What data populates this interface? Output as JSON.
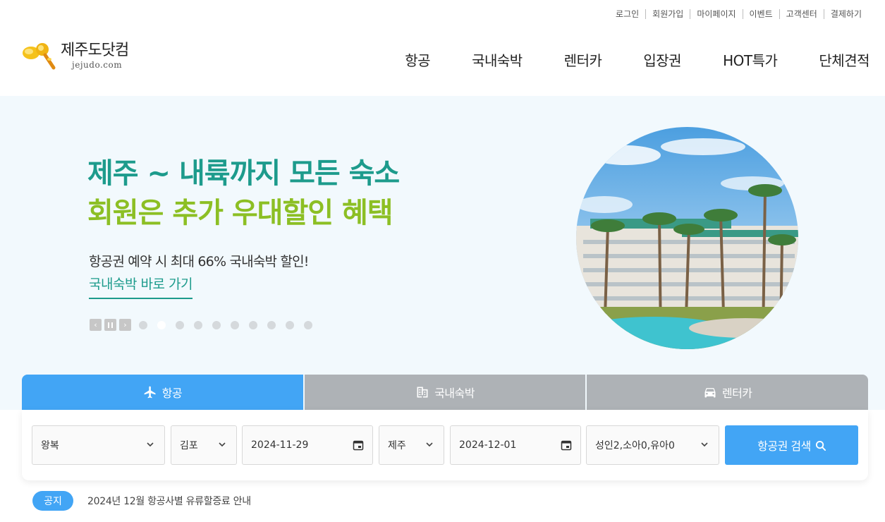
{
  "utility_nav": [
    "로그인",
    "회원가입",
    "마이페이지",
    "이벤트",
    "고객센터",
    "결제하기"
  ],
  "logo": {
    "name": "제주도닷컴",
    "domain": "jejudo.com"
  },
  "main_nav": [
    "항공",
    "국내숙박",
    "렌터카",
    "입장권",
    "HOT특가",
    "단체견적"
  ],
  "hero": {
    "title_line1": "제주 ~ 내륙까지 모든 숙소",
    "title_line2": "회원은 추가 우대할인 혜택",
    "subtitle": "항공권 예약 시 최대 66% 국내숙박 할인!",
    "link": "국내숙박 바로 가기",
    "slide_count": 10,
    "active_slide": 2
  },
  "search_tabs": [
    {
      "label": "항공",
      "icon": "airplane-icon",
      "active": true
    },
    {
      "label": "국내숙박",
      "icon": "building-icon",
      "active": false
    },
    {
      "label": "렌터카",
      "icon": "car-icon",
      "active": false
    }
  ],
  "search_form": {
    "trip_type": "왕복",
    "departure": "김포",
    "depart_date": "2024-11-29",
    "arrival": "제주",
    "return_date": "2024-12-01",
    "passengers": "성인2,소아0,유아0",
    "submit_label": "항공권 검색"
  },
  "notice": {
    "badge": "공지",
    "text": "2024년 12월 항공사별 유류할증료 안내"
  },
  "colors": {
    "accent_blue": "#42a5f5",
    "hero_teal": "#1d9b8c",
    "hero_green": "#8cbf24",
    "tab_inactive": "#aeb2b6",
    "hero_bg": "#f2f9fd"
  }
}
